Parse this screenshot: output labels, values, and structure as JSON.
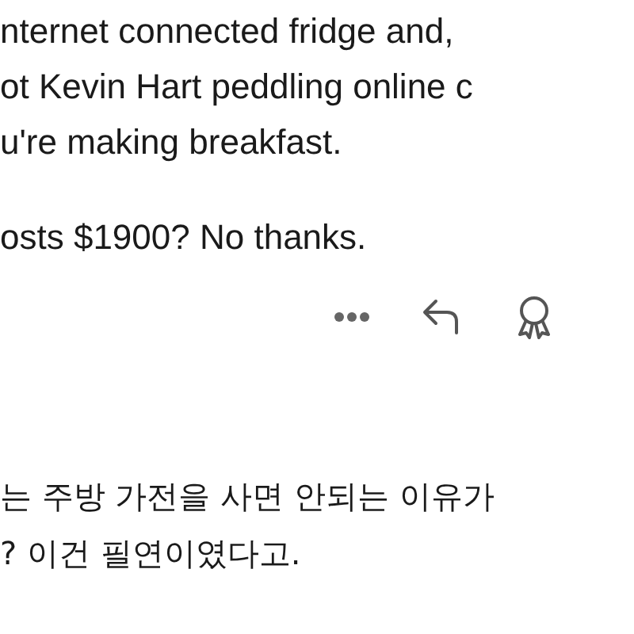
{
  "comment": {
    "lines": [
      "nternet connected fridge and,",
      "ot Kevin Hart peddling online c",
      "u're making breakfast.",
      "osts $1900? No thanks."
    ]
  },
  "actions": [
    {
      "kind": "more"
    },
    {
      "kind": "reply"
    },
    {
      "kind": "award"
    }
  ],
  "translation": {
    "lines": [
      "는 주방 가전을 사면 안되는 이유가",
      "? 이건 필연이였다고."
    ]
  }
}
